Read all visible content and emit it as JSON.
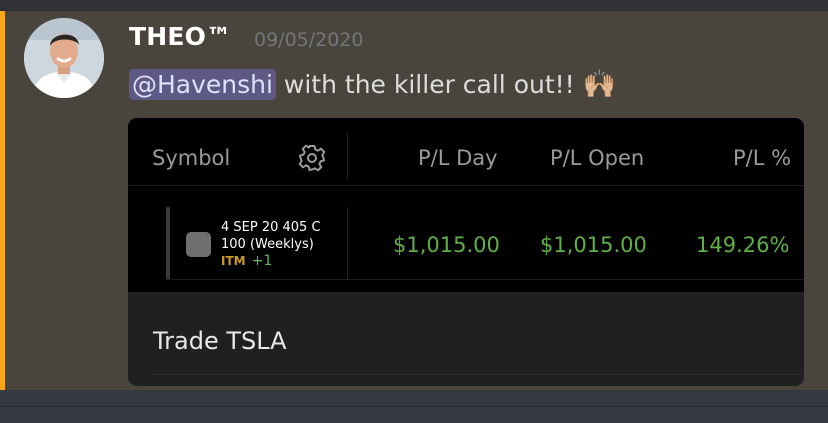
{
  "message": {
    "username": "THEO™",
    "timestamp": "09/05/2020",
    "mention": "@Havenshi",
    "text": " with the killer call out!! ",
    "emoji": "🙌🏼"
  },
  "card": {
    "headers": {
      "symbol": "Symbol",
      "pl_day": "P/L Day",
      "pl_open": "P/L Open",
      "pl_pct": "P/L %"
    },
    "row": {
      "contract_line1": "4 SEP 20 405 C",
      "contract_line2": "100 (Weeklys)",
      "itm": "ITM",
      "plus": "+1",
      "pl_day": "$1,015.00",
      "pl_open": "$1,015.00",
      "pl_pct": "149.26%"
    },
    "trade_label": "Trade TSLA"
  },
  "colors": {
    "highlight_bar": "#faa81a",
    "mention_bg": "#5e5884",
    "positive_value": "#5fb046",
    "itm": "#c89a2a"
  }
}
